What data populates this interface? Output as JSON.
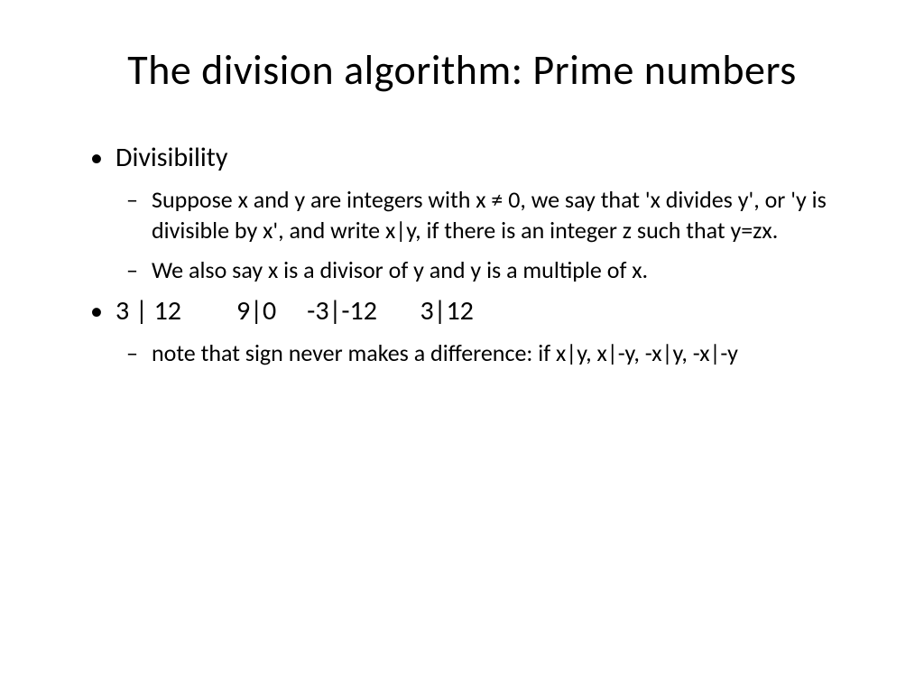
{
  "title": "The division algorithm: Prime numbers",
  "bullets": {
    "item1": {
      "label": "Divisibility",
      "sub1": "Suppose x and y are integers with x ≠ 0, we say that 'x divides y', or 'y is divisible by x', and write x|y, if there is an integer z such that y=zx.",
      "sub2": "We also say x is a divisor of y and y is a multiple of x."
    },
    "item2": {
      "label": "3 | 12         9|0     -3|-12       3|12",
      "sub1": "note that sign never makes a difference: if x|y, x|-y, -x|y,   -x|-y"
    }
  }
}
